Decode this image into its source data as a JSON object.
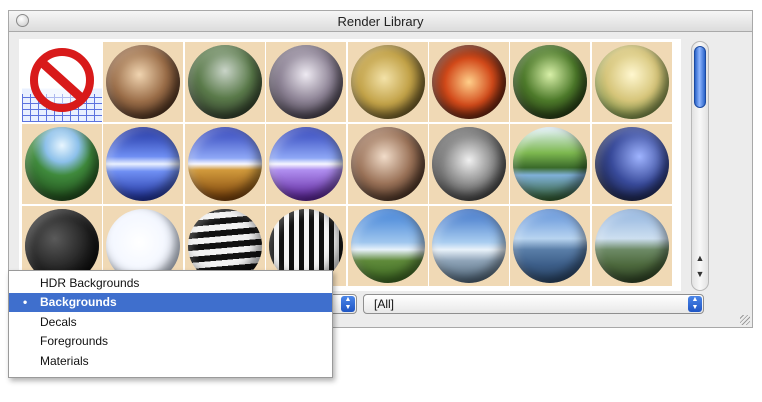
{
  "window": {
    "title": "Render Library"
  },
  "tiles": [
    {
      "kind": "none",
      "icon": "no-entry-icon"
    },
    {
      "bg": "radial-gradient(circle at 45% 40%,#f0d4b0,#9a6d48 45%,#4b2e1c 80%)"
    },
    {
      "bg": "radial-gradient(circle at 50% 35%,#c9d4c8,#5a7a4a 45%,#2f3a2a 85%)"
    },
    {
      "bg": "radial-gradient(circle at 50% 40%,#eeeaf2,#8e8496 45%,#3a3440 85%)"
    },
    {
      "bg": "radial-gradient(circle at 45% 45%,#f3e2a8,#c2a248 45%,#5b4a1e 85%)"
    },
    {
      "bg": "radial-gradient(circle at 50% 50%,#ffcf8a,#d24a1a 45%,#3a120a 85%)"
    },
    {
      "bg": "radial-gradient(circle at 50% 40%,#d8f0a8,#4d7a2a 45%,#1d2e10 85%)"
    },
    {
      "bg": "radial-gradient(circle at 50% 40%,#fff7cf,#d6c57a 45%,#6b8a3d 85%)"
    },
    {
      "bg": "radial-gradient(circle at 50% 25%,#e8f6ff 0%,#8cc0ea 25%,#3f8a3c 45%,#1f4a1a 85%)"
    },
    {
      "bg": "linear-gradient(#1c2f9e 0%,#6f8ff3 40%,#e9f0ff 50%,#6f8ff3 60%,#1c2f9e 100%)"
    },
    {
      "bg": "linear-gradient(#2c3fb8 0%,#8fa8f6 42%,#f7f7ff 50%,#d19a3c 58%,#7a3f08 100%)"
    },
    {
      "bg": "linear-gradient(#2c3fb8 0%,#8fa8f6 42%,#f7f7ff 50%,#b08ff0 58%,#5a1f9a 100%)"
    },
    {
      "bg": "radial-gradient(circle at 45% 40%,#f1dcc9,#9a7258 45%,#3a2418 85%)"
    },
    {
      "bg": "radial-gradient(circle at 50% 45%,#f0f0f0,#8a8a8a 45%,#2c2c2c 85%)"
    },
    {
      "bg": "linear-gradient(#e6f4ff 0%,#7db84f 35%,#3a6a2a 55%,#7fb0d8 65%,#2e5a28 100%)"
    },
    {
      "bg": "radial-gradient(circle at 60% 40%,#9fb4ff,#384a9a 45%,#10152e 85%)"
    },
    {
      "bg": "radial-gradient(circle at 40% 40%,#5a5a5a,#1e1e1e 55%,#050505 90%)"
    },
    {
      "bg": "radial-gradient(circle at 45% 45%,#ffffff,#f2f6ff 55%,#c9d6ea 85%)"
    },
    {
      "bg": "repeating-linear-gradient(175deg,#111 0 6px,#f2f2f2 6px 12px)"
    },
    {
      "bg": "repeating-linear-gradient(90deg,#111 0 5px,#f5f5f5 5px 10px)"
    },
    {
      "bg": "linear-gradient(#3d7fd6 0%,#9fc6ee 45%,#e8f2fb 55%,#5f8a3a 70%,#3d6a22 100%)"
    },
    {
      "bg": "linear-gradient(#3b72c8 0%,#a9cdf0 45%,#e9f2fa 55%,#8fa4b8 70%,#4d6478 100%)"
    },
    {
      "bg": "linear-gradient(#5c8fd8 0%,#b8d4f0 40%,#5a7ea8 55%,#3d5f8a 75%,#2a4566 100%)"
    },
    {
      "bg": "linear-gradient(#8fb2de 0%,#cddff0 40%,#6d8a66 55%,#4e6a3e 75%,#2f4426 100%)"
    }
  ],
  "dropdown": {
    "items": [
      {
        "label": "HDR Backgrounds",
        "selected": false
      },
      {
        "label": "Backgrounds",
        "selected": true
      },
      {
        "label": "Decals",
        "selected": false
      },
      {
        "label": "Foregrounds",
        "selected": false
      },
      {
        "label": "Materials",
        "selected": false
      }
    ],
    "check_glyph": "•"
  },
  "filter_popup": {
    "value": "[All]"
  },
  "scrollbar": {
    "up_glyph": "▲",
    "down_glyph": "▼"
  },
  "colors": {
    "selection": "#3f6fcd",
    "scroll_thumb": "#2a63c8"
  }
}
